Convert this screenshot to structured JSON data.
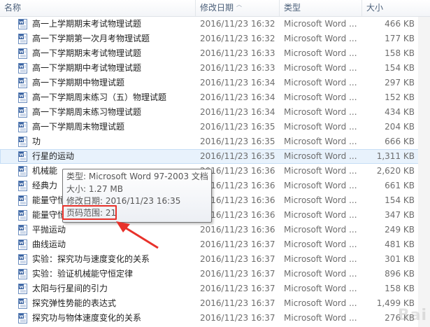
{
  "columns": {
    "name": "名称",
    "date": "修改日期",
    "type": "类型",
    "size": "大小"
  },
  "files": [
    {
      "name": "高一上学期期末考试物理试题",
      "date": "2016/11/23 16:32",
      "type": "Microsoft Word ...",
      "size": "466 KB"
    },
    {
      "name": "高一下学期第一次月考物理试题",
      "date": "2016/11/23 16:32",
      "type": "Microsoft Word ...",
      "size": "177 KB"
    },
    {
      "name": "高一下学期期末考试物理试题",
      "date": "2016/11/23 16:33",
      "type": "Microsoft Word ...",
      "size": "158 KB"
    },
    {
      "name": "高一下学期期中考试物理试题",
      "date": "2016/11/23 16:33",
      "type": "Microsoft Word ...",
      "size": "154 KB"
    },
    {
      "name": "高一下学期期中物理试题",
      "date": "2016/11/23 16:34",
      "type": "Microsoft Word ...",
      "size": "297 KB"
    },
    {
      "name": "高一下学期周末练习（五）物理试题",
      "date": "2016/11/23 16:34",
      "type": "Microsoft Word ...",
      "size": "152 KB"
    },
    {
      "name": "高一下学期周末练习物理试题",
      "date": "2016/11/23 16:34",
      "type": "Microsoft Word ...",
      "size": "434 KB"
    },
    {
      "name": "高一下学期周末物理试题",
      "date": "2016/11/23 16:35",
      "type": "Microsoft Word ...",
      "size": "204 KB"
    },
    {
      "name": "功",
      "date": "2016/11/23 16:35",
      "type": "Microsoft Word ...",
      "size": "666 KB"
    },
    {
      "name": "行星的运动",
      "date": "2016/11/23 16:35",
      "type": "Microsoft Word ...",
      "size": "1,311 KB"
    },
    {
      "name": "机械能",
      "date": "2016/11/23 16:36",
      "type": "Microsoft Word ...",
      "size": "2,620 KB"
    },
    {
      "name": "经典力",
      "date": "2016/11/23 16:36",
      "type": "Microsoft Word ...",
      "size": "661 KB"
    },
    {
      "name": "能量守恒",
      "date": "2016/11/23 16:36",
      "type": "Microsoft Word ...",
      "size": "154 KB"
    },
    {
      "name": "能量守恒",
      "date": "2016/11/23 16:36",
      "type": "Microsoft Word ...",
      "size": "347 KB"
    },
    {
      "name": "平抛运动",
      "date": "2016/11/23 16:36",
      "type": "Microsoft Word ...",
      "size": "249 KB"
    },
    {
      "name": "曲线运动",
      "date": "2016/11/23 16:37",
      "type": "Microsoft Word ...",
      "size": "481 KB"
    },
    {
      "name": "实验：探究功与速度变化的关系",
      "date": "2016/11/23 16:37",
      "type": "Microsoft Word ...",
      "size": "301 KB"
    },
    {
      "name": "实验：验证机械能守恒定律",
      "date": "2016/11/23 16:37",
      "type": "Microsoft Word ...",
      "size": "896 KB"
    },
    {
      "name": "太阳与行星间的引力",
      "date": "2016/11/23 16:37",
      "type": "Microsoft Word ...",
      "size": "158 KB"
    },
    {
      "name": "探究弹性势能的表达式",
      "date": "2016/11/23 16:37",
      "type": "Microsoft Word ...",
      "size": "1,499 KB"
    },
    {
      "name": "探究功与物体速度变化的关系",
      "date": "2016/11/23 16:37",
      "type": "Microsoft Word ...",
      "size": "276 KB"
    }
  ],
  "tooltip": {
    "type": "类型: Microsoft Word 97-2003 文档",
    "size": "大小: 1.27 MB",
    "date": "修改日期: 2016/11/23 16:35",
    "pages": "页码范围: 21"
  },
  "colors": {
    "highlight": "#e8312a",
    "hover_row": "#e8f2fc",
    "header_text": "#4c607a"
  }
}
